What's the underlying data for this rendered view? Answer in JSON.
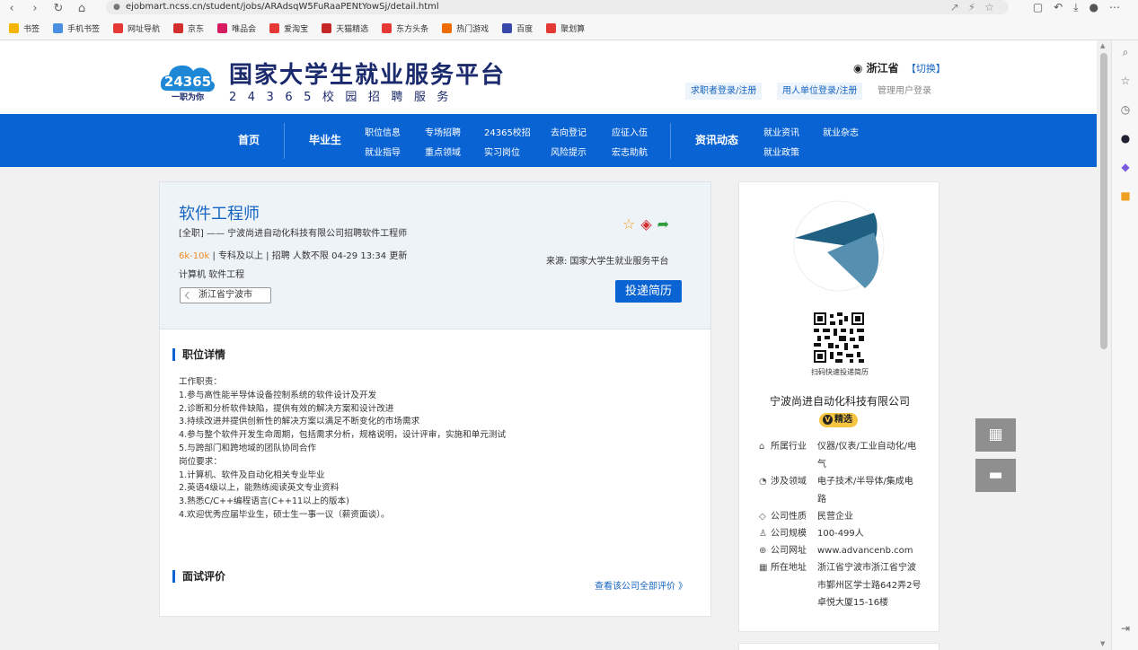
{
  "browser": {
    "url": "ejobmart.ncss.cn/student/jobs/ARAdsqW5FuRaaPENtYowSj/detail.html",
    "bookmarks": [
      "书签",
      "手机书签",
      "网址导航",
      "京东",
      "唯品会",
      "爱淘宝",
      "天猫精选",
      "东方头条",
      "热门游戏",
      "百度",
      "聚划算"
    ],
    "bookmark_colors": [
      "#f5b400",
      "#4a90e2",
      "#e53935",
      "#d32f2f",
      "#d81b60",
      "#e53935",
      "#c62828",
      "#e53935",
      "#ef6c00",
      "#3949ab",
      "#e53935"
    ]
  },
  "header": {
    "logo_num": "24365",
    "logo_slogan": "一职为你",
    "title": "国家大学生就业服务平台",
    "subtitle": "24365校园招聘服务",
    "location": "浙江省",
    "location_switch": "【切换】",
    "seeker_login": "求职者登录/注册",
    "employer_login": "用人单位登录/注册",
    "admin_login": "管理用户登录"
  },
  "nav": {
    "home": "首页",
    "graduate": "毕业生",
    "sub_a": [
      "职位信息",
      "专场招聘",
      "24365校招",
      "去向登记",
      "应征入伍"
    ],
    "sub_b": [
      "就业指导",
      "重点领域",
      "实习岗位",
      "风险提示",
      "宏志助航"
    ],
    "news": "资讯动态",
    "news_a": [
      "就业资讯",
      "就业杂志"
    ],
    "news_b": [
      "就业政策"
    ]
  },
  "job": {
    "title": "软件工程师",
    "company_line": "[全职]  ——  宁波尚进自动化科技有限公司招聘软件工程师",
    "salary": "6k-10k",
    "meta_rest": "  |  专科及以上  |  招聘 人数不限  04-29 13:34 更新",
    "category": "计算机 软件工程",
    "location_tag": "浙江省宁波市",
    "source": "来源:   国家大学生就业服务平台",
    "apply": "投递简历"
  },
  "detail": {
    "section_title": "职位详情",
    "description": [
      "工作职责：",
      "1.参与高性能半导体设备控制系统的软件设计及开发",
      "2.诊断和分析软件缺陷，提供有效的解决方案和设计改进",
      "3.持续改进并提供创新性的解决方案以满足不断变化的市场需求",
      "4.参与整个软件开发生命周期，包括需求分析，规格说明，设计评审，实施和单元测试",
      "5.与跨部门和跨地域的团队协同合作",
      "岗位要求：",
      "1.计算机、软件及自动化相关专业毕业",
      "2.英语4级以上，能熟练阅读英文专业资料",
      "3.熟悉C/C++编程语言(C++11以上的版本)",
      "4.欢迎优秀应届毕业生，硕士生一事一议（薪资面谈）。"
    ],
    "review_title": "面试评价",
    "review_link": "查看该公司全部评价  》"
  },
  "company": {
    "qr_caption": "扫码快速投递简历",
    "name": "宁波尚进自动化科技有限公司",
    "badge": "精选",
    "badge_v": "V",
    "industry_label": "所属行业",
    "industry": "仪器/仪表/工业自动化/电气",
    "field_label": "涉及领域",
    "field": "电子技术/半导体/集成电路",
    "nature_label": "公司性质",
    "nature": "民营企业",
    "scale_label": "公司规模",
    "scale": "100-499人",
    "website_label": "公司网址",
    "website": "www.advancenb.com",
    "address_label": "所在地址",
    "address": "浙江省宁波市浙江省宁波市鄞州区学士路642弄2号卓悦大厦15-16楼"
  },
  "colors": {
    "primary": "#0a63d2",
    "salary": "#f08a24",
    "badge": "#f5c542",
    "logo_dark": "#1f5f82",
    "logo_light": "#5590b0"
  }
}
